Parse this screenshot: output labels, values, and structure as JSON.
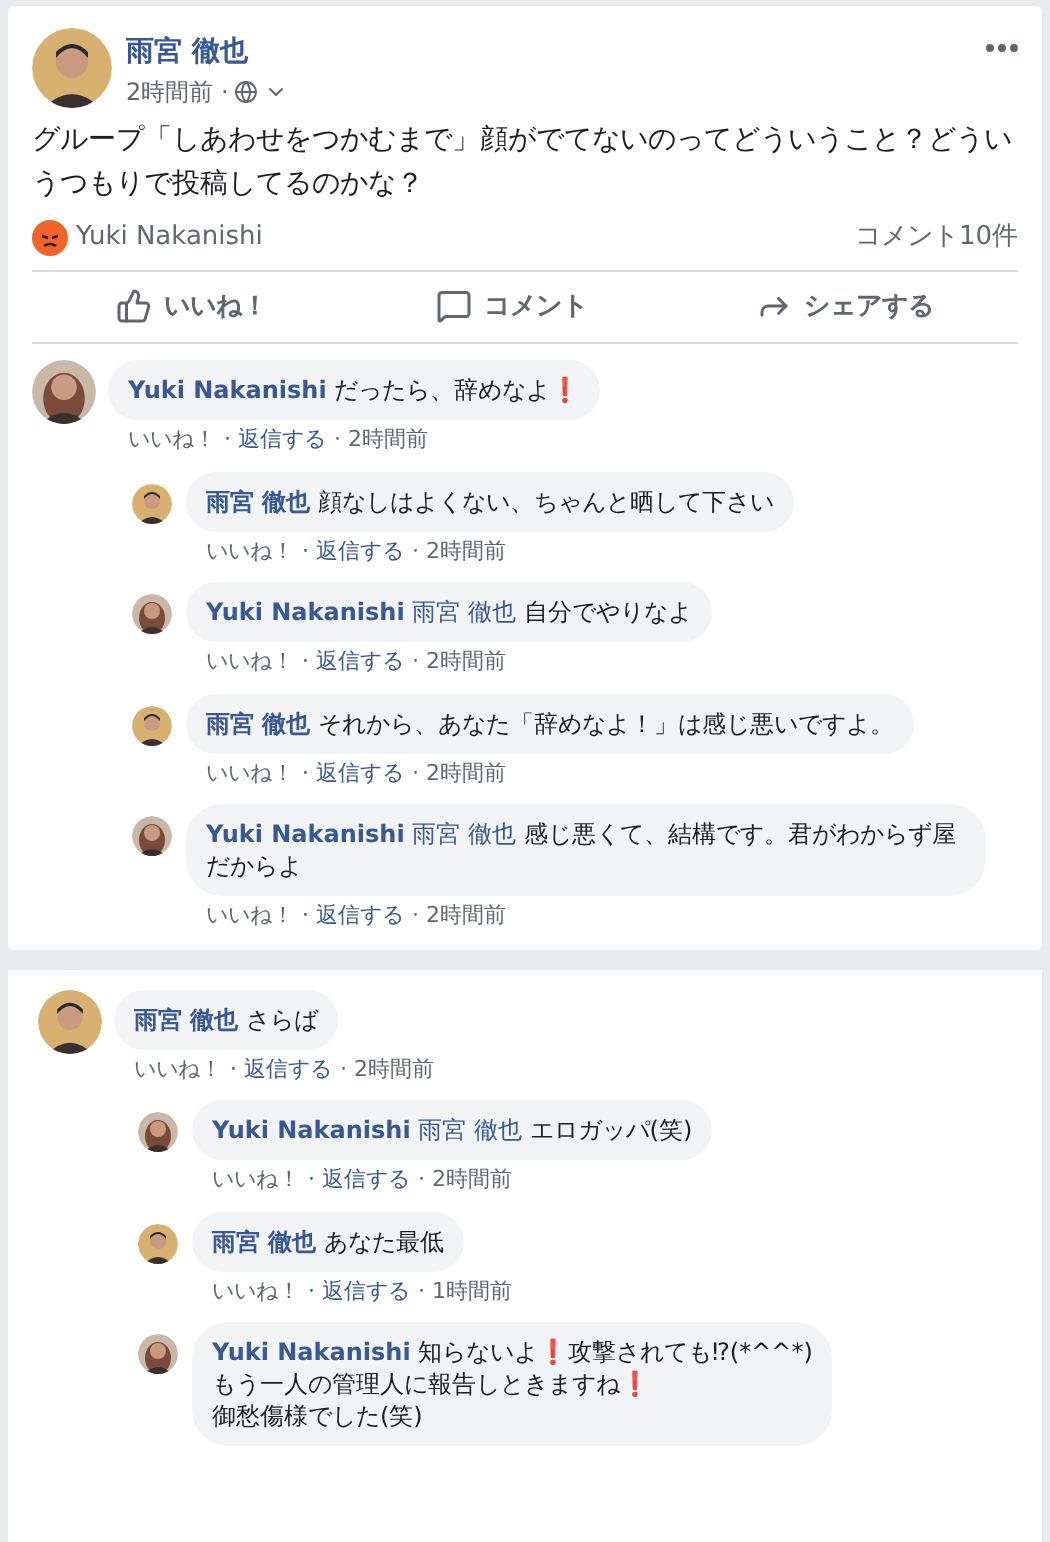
{
  "post": {
    "author": "雨宮 徹也",
    "time": "2時間前 ·",
    "text": "グループ「しあわせをつかむまで」顔がでてないのってどういうこと？どういうつもりで投稿してるのかな？",
    "reactor": "Yuki Nakanishi",
    "comment_count": "コメント10件",
    "actions": [
      {
        "kind": "like",
        "label": "いいね！"
      },
      {
        "kind": "comment",
        "label": "コメント"
      },
      {
        "kind": "share",
        "label": "シェアする"
      }
    ]
  },
  "comment_sections": [
    {
      "comments": [
        {
          "author": "Yuki Nakanishi",
          "kind": "woman",
          "text": "だったら、辞めなよ❗",
          "meta": [
            "いいね！",
            "· 返信する",
            "· 2時間前"
          ],
          "children": [
            {
              "author": "雨宮 徹也",
              "kind": "man",
              "text": "顔なしはよくない、ちゃんと晒して下さい",
              "meta": [
                "いいね！",
                "· 返信する",
                "· 2時間前"
              ]
            },
            {
              "author": "Yuki Nakanishi",
              "kind": "woman",
              "mention": "雨宮 徹也",
              "text": "自分でやりなよ",
              "meta": [
                "いいね！",
                "· 返信する",
                "· 2時間前"
              ]
            },
            {
              "author": "雨宮 徹也",
              "kind": "man",
              "text": "それから、あなた「辞めなよ！」は感じ悪いですよ。",
              "meta": [
                "いいね！",
                "· 返信する",
                "· 2時間前"
              ]
            },
            {
              "author": "Yuki Nakanishi",
              "kind": "woman",
              "mention": "雨宮 徹也",
              "text": "感じ悪くて、結構です。君がわからず屋だからよ",
              "meta": [
                "いいね！",
                "· 返信する",
                "· 2時間前"
              ]
            }
          ]
        }
      ]
    },
    {
      "comments": [
        {
          "author": "雨宮 徹也",
          "kind": "man",
          "text": "さらば",
          "meta": [
            "いいね！",
            "· 返信する",
            "· 2時間前"
          ],
          "children": [
            {
              "author": "Yuki Nakanishi",
              "kind": "woman",
              "mention": "雨宮 徹也",
              "text": "エロガッパ(笑)",
              "meta": [
                "いいね！",
                "· 返信する",
                "· 2時間前"
              ]
            },
            {
              "author": "雨宮 徹也",
              "kind": "man",
              "text": "あなた最低",
              "meta": [
                "いいね！",
                "· 返信する",
                "· 1時間前"
              ]
            },
            {
              "author": "Yuki Nakanishi",
              "kind": "woman",
              "text": "知らないよ❗攻撃されても⁉(*^^*)\nもう一人の管理人に報告しときますね❗\n御愁傷様でした(笑)"
            }
          ]
        }
      ]
    }
  ]
}
